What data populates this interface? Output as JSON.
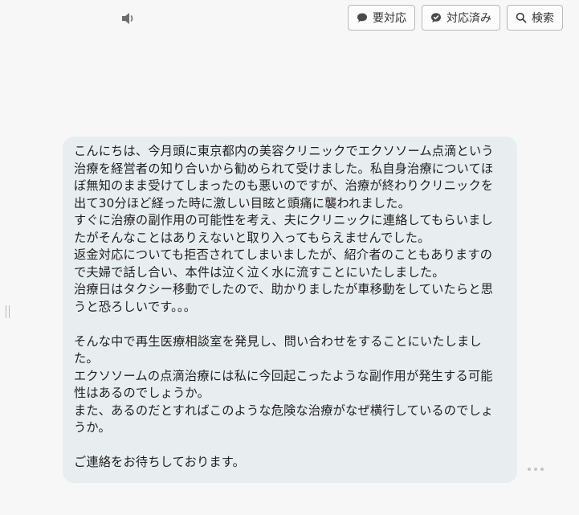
{
  "toolbar": {
    "needs_action_label": "要対応",
    "resolved_label": "対応済み",
    "search_label": "検索"
  },
  "message": {
    "body": "こんにちは、今月頭に東京都内の美容クリニックでエクソソーム点滴という治療を経営者の知り合いから勧められて受けました。私自身治療についてほぼ無知のまま受けてしまったのも悪いのですが、治療が終わりクリニックを出て30分ほど経った時に激しい目眩と頭痛に襲われました。\nすぐに治療の副作用の可能性を考え、夫にクリニックに連絡してもらいましたがそんなことはありえないと取り入ってもらえませんでした。\n返金対応についても拒否されてしまいましたが、紹介者のこともありますので夫婦で話し合い、本件は泣く泣く水に流すことにいたしました。\n治療日はタクシー移動でしたので、助かりましたが車移動をしていたらと思うと恐ろしいです。。。\n\nそんな中で再生医療相談室を発見し、問い合わせをすることにいたしました。\nエクソソームの点滴治療には私に今回起こったような副作用が発生する可能性はあるのでしょうか。\nまた、あるのだとすればこのような危険な治療がなぜ横行しているのでしょうか。\n\nご連絡をお待ちしております。"
  }
}
